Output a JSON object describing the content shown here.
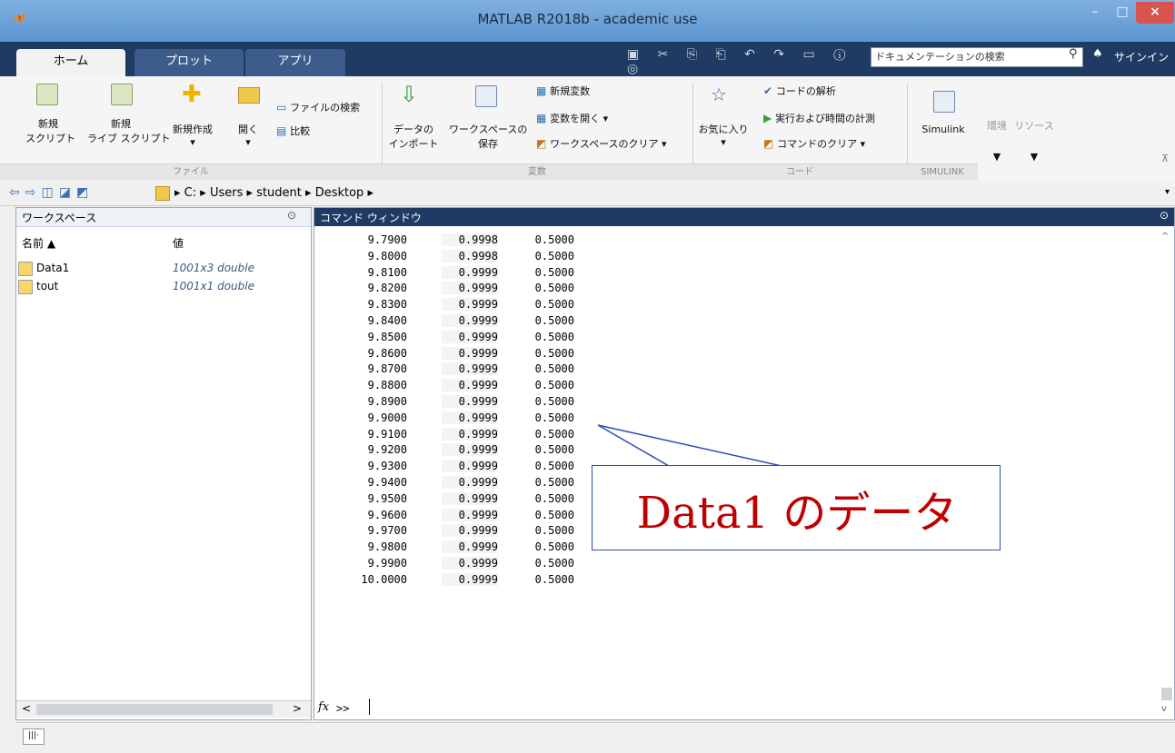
{
  "window": {
    "title": "MATLAB R2018b - academic use",
    "min": "–",
    "max": "□",
    "close": "×"
  },
  "tabs": [
    "ホーム",
    "プロット",
    "アプリ"
  ],
  "search": {
    "placeholder": "ドキュメンテーションの検索"
  },
  "signin": "サインイン",
  "ribbon": {
    "file": {
      "new_script": [
        "新規",
        "スクリプト"
      ],
      "new_live_script": [
        "新規",
        "ライブ スクリプト"
      ],
      "new": "新規作成",
      "open": "開く",
      "find_files": "ファイルの検索",
      "compare": "比較",
      "group": "ファイル"
    },
    "variable": {
      "import": [
        "データの",
        "インポート"
      ],
      "save_ws": [
        "ワークスペースの",
        "保存"
      ],
      "new_var": "新規変数",
      "open_var": "変数を開く ▾",
      "clear_ws": "ワークスペースのクリア ▾",
      "group": "変数"
    },
    "code": {
      "favorites": "お気に入り",
      "analyze": "コードの解析",
      "run_time": "実行および時間の計測",
      "clear_cmds": "コマンドのクリア ▾",
      "group": "コード"
    },
    "simulink": {
      "label": "Simulink",
      "group": "SIMULINK"
    },
    "environment": "環境",
    "resources": "リソース"
  },
  "path": [
    "C:",
    "Users",
    "student",
    "Desktop"
  ],
  "workspace": {
    "title": "ワークスペース",
    "col_name": "名前 ▲",
    "col_value": "値",
    "rows": [
      {
        "name": "Data1",
        "value": "1001x3 double"
      },
      {
        "name": "tout",
        "value": "1001x1 double"
      }
    ]
  },
  "command_window": {
    "title": "コマンド ウィンドウ",
    "rows": [
      [
        "9.7900",
        "0.9998",
        "0.5000"
      ],
      [
        "9.8000",
        "0.9998",
        "0.5000"
      ],
      [
        "9.8100",
        "0.9999",
        "0.5000"
      ],
      [
        "9.8200",
        "0.9999",
        "0.5000"
      ],
      [
        "9.8300",
        "0.9999",
        "0.5000"
      ],
      [
        "9.8400",
        "0.9999",
        "0.5000"
      ],
      [
        "9.8500",
        "0.9999",
        "0.5000"
      ],
      [
        "9.8600",
        "0.9999",
        "0.5000"
      ],
      [
        "9.8700",
        "0.9999",
        "0.5000"
      ],
      [
        "9.8800",
        "0.9999",
        "0.5000"
      ],
      [
        "9.8900",
        "0.9999",
        "0.5000"
      ],
      [
        "9.9000",
        "0.9999",
        "0.5000"
      ],
      [
        "9.9100",
        "0.9999",
        "0.5000"
      ],
      [
        "9.9200",
        "0.9999",
        "0.5000"
      ],
      [
        "9.9300",
        "0.9999",
        "0.5000"
      ],
      [
        "9.9400",
        "0.9999",
        "0.5000"
      ],
      [
        "9.9500",
        "0.9999",
        "0.5000"
      ],
      [
        "9.9600",
        "0.9999",
        "0.5000"
      ],
      [
        "9.9700",
        "0.9999",
        "0.5000"
      ],
      [
        "9.9800",
        "0.9999",
        "0.5000"
      ],
      [
        "9.9900",
        "0.9999",
        "0.5000"
      ],
      [
        "10.0000",
        "0.9999",
        "0.5000"
      ]
    ],
    "prompt_fx": "fx",
    "prompt": ">>"
  },
  "callout": {
    "text": "Data1 のデータ"
  },
  "colors": {
    "accent": "#1f3b63",
    "callout_text": "#c00000",
    "callout_border": "#2b4bb8"
  }
}
